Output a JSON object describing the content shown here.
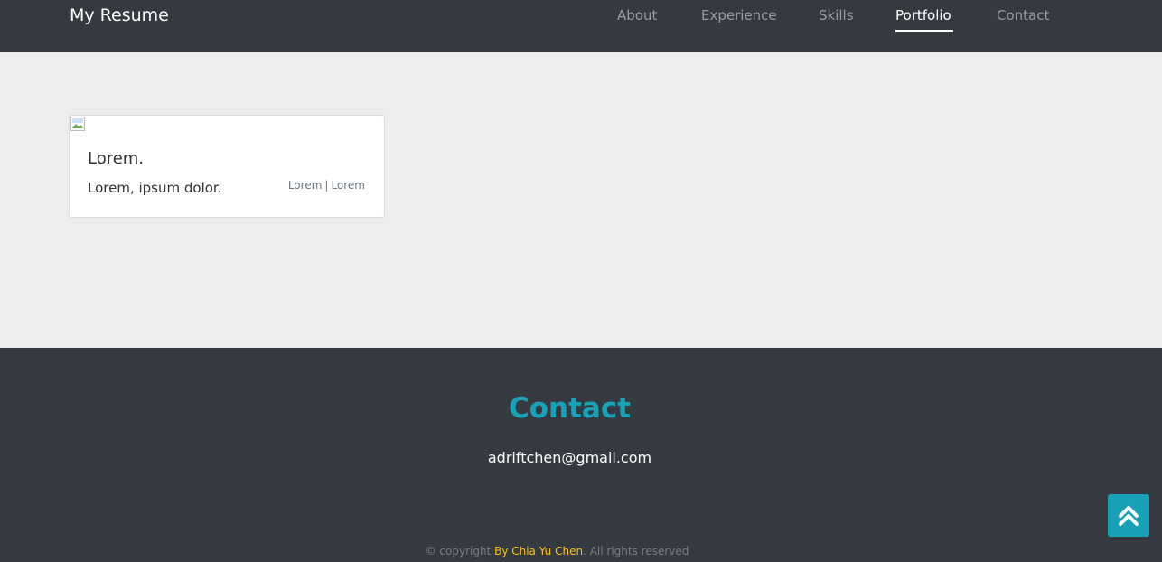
{
  "navbar": {
    "brand": "My Resume",
    "items": [
      {
        "label": "About",
        "active": false
      },
      {
        "label": "Experience",
        "active": false
      },
      {
        "label": "Skills",
        "active": false
      },
      {
        "label": "Portfolio",
        "active": true
      },
      {
        "label": "Contact",
        "active": false
      }
    ]
  },
  "portfolio": {
    "cards": [
      {
        "image_icon": "broken-image-icon",
        "title": "Lorem.",
        "text": "Lorem, ipsum dolor.",
        "tags": [
          "Lorem",
          "Lorem"
        ],
        "tag_separator": "|"
      }
    ]
  },
  "contact": {
    "title": "Contact",
    "email": "adriftchen@gmail.com"
  },
  "footer": {
    "prefix": "© copyright ",
    "author": "By Chia Yu Chen",
    "suffix": ". All rights reserved"
  },
  "back_to_top": {
    "icon": "double-chevron-up-icon"
  },
  "colors": {
    "dark_bg": "#343a40",
    "light_bg": "#ededed",
    "accent": "#17a2b8",
    "author_highlight": "#ffc107",
    "nav_inactive": "#9a9da1"
  }
}
